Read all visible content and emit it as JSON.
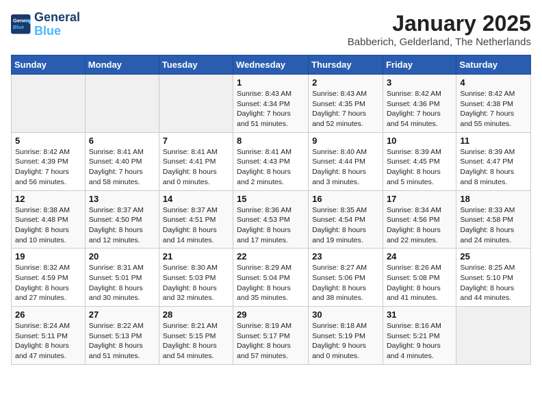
{
  "logo": {
    "line1": "General",
    "line2": "Blue"
  },
  "title": "January 2025",
  "subtitle": "Babberich, Gelderland, The Netherlands",
  "days_header": [
    "Sunday",
    "Monday",
    "Tuesday",
    "Wednesday",
    "Thursday",
    "Friday",
    "Saturday"
  ],
  "weeks": [
    [
      {
        "num": "",
        "info": ""
      },
      {
        "num": "",
        "info": ""
      },
      {
        "num": "",
        "info": ""
      },
      {
        "num": "1",
        "info": "Sunrise: 8:43 AM\nSunset: 4:34 PM\nDaylight: 7 hours\nand 51 minutes."
      },
      {
        "num": "2",
        "info": "Sunrise: 8:43 AM\nSunset: 4:35 PM\nDaylight: 7 hours\nand 52 minutes."
      },
      {
        "num": "3",
        "info": "Sunrise: 8:42 AM\nSunset: 4:36 PM\nDaylight: 7 hours\nand 54 minutes."
      },
      {
        "num": "4",
        "info": "Sunrise: 8:42 AM\nSunset: 4:38 PM\nDaylight: 7 hours\nand 55 minutes."
      }
    ],
    [
      {
        "num": "5",
        "info": "Sunrise: 8:42 AM\nSunset: 4:39 PM\nDaylight: 7 hours\nand 56 minutes."
      },
      {
        "num": "6",
        "info": "Sunrise: 8:41 AM\nSunset: 4:40 PM\nDaylight: 7 hours\nand 58 minutes."
      },
      {
        "num": "7",
        "info": "Sunrise: 8:41 AM\nSunset: 4:41 PM\nDaylight: 8 hours\nand 0 minutes."
      },
      {
        "num": "8",
        "info": "Sunrise: 8:41 AM\nSunset: 4:43 PM\nDaylight: 8 hours\nand 2 minutes."
      },
      {
        "num": "9",
        "info": "Sunrise: 8:40 AM\nSunset: 4:44 PM\nDaylight: 8 hours\nand 3 minutes."
      },
      {
        "num": "10",
        "info": "Sunrise: 8:39 AM\nSunset: 4:45 PM\nDaylight: 8 hours\nand 5 minutes."
      },
      {
        "num": "11",
        "info": "Sunrise: 8:39 AM\nSunset: 4:47 PM\nDaylight: 8 hours\nand 8 minutes."
      }
    ],
    [
      {
        "num": "12",
        "info": "Sunrise: 8:38 AM\nSunset: 4:48 PM\nDaylight: 8 hours\nand 10 minutes."
      },
      {
        "num": "13",
        "info": "Sunrise: 8:37 AM\nSunset: 4:50 PM\nDaylight: 8 hours\nand 12 minutes."
      },
      {
        "num": "14",
        "info": "Sunrise: 8:37 AM\nSunset: 4:51 PM\nDaylight: 8 hours\nand 14 minutes."
      },
      {
        "num": "15",
        "info": "Sunrise: 8:36 AM\nSunset: 4:53 PM\nDaylight: 8 hours\nand 17 minutes."
      },
      {
        "num": "16",
        "info": "Sunrise: 8:35 AM\nSunset: 4:54 PM\nDaylight: 8 hours\nand 19 minutes."
      },
      {
        "num": "17",
        "info": "Sunrise: 8:34 AM\nSunset: 4:56 PM\nDaylight: 8 hours\nand 22 minutes."
      },
      {
        "num": "18",
        "info": "Sunrise: 8:33 AM\nSunset: 4:58 PM\nDaylight: 8 hours\nand 24 minutes."
      }
    ],
    [
      {
        "num": "19",
        "info": "Sunrise: 8:32 AM\nSunset: 4:59 PM\nDaylight: 8 hours\nand 27 minutes."
      },
      {
        "num": "20",
        "info": "Sunrise: 8:31 AM\nSunset: 5:01 PM\nDaylight: 8 hours\nand 30 minutes."
      },
      {
        "num": "21",
        "info": "Sunrise: 8:30 AM\nSunset: 5:03 PM\nDaylight: 8 hours\nand 32 minutes."
      },
      {
        "num": "22",
        "info": "Sunrise: 8:29 AM\nSunset: 5:04 PM\nDaylight: 8 hours\nand 35 minutes."
      },
      {
        "num": "23",
        "info": "Sunrise: 8:27 AM\nSunset: 5:06 PM\nDaylight: 8 hours\nand 38 minutes."
      },
      {
        "num": "24",
        "info": "Sunrise: 8:26 AM\nSunset: 5:08 PM\nDaylight: 8 hours\nand 41 minutes."
      },
      {
        "num": "25",
        "info": "Sunrise: 8:25 AM\nSunset: 5:10 PM\nDaylight: 8 hours\nand 44 minutes."
      }
    ],
    [
      {
        "num": "26",
        "info": "Sunrise: 8:24 AM\nSunset: 5:11 PM\nDaylight: 8 hours\nand 47 minutes."
      },
      {
        "num": "27",
        "info": "Sunrise: 8:22 AM\nSunset: 5:13 PM\nDaylight: 8 hours\nand 51 minutes."
      },
      {
        "num": "28",
        "info": "Sunrise: 8:21 AM\nSunset: 5:15 PM\nDaylight: 8 hours\nand 54 minutes."
      },
      {
        "num": "29",
        "info": "Sunrise: 8:19 AM\nSunset: 5:17 PM\nDaylight: 8 hours\nand 57 minutes."
      },
      {
        "num": "30",
        "info": "Sunrise: 8:18 AM\nSunset: 5:19 PM\nDaylight: 9 hours\nand 0 minutes."
      },
      {
        "num": "31",
        "info": "Sunrise: 8:16 AM\nSunset: 5:21 PM\nDaylight: 9 hours\nand 4 minutes."
      },
      {
        "num": "",
        "info": ""
      }
    ]
  ]
}
